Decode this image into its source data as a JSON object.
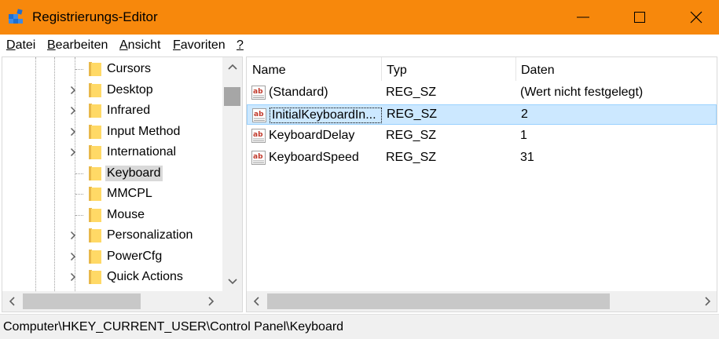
{
  "window": {
    "title": "Registrierungs-Editor",
    "icon": "registry-editor-icon"
  },
  "menu": [
    {
      "label": "Datei",
      "access_key": "D",
      "rest": "atei"
    },
    {
      "label": "Bearbeiten",
      "access_key": "B",
      "rest": "earbeiten"
    },
    {
      "label": "Ansicht",
      "access_key": "A",
      "rest": "nsicht"
    },
    {
      "label": "Favoriten",
      "access_key": "F",
      "rest": "avoriten"
    },
    {
      "label": "?",
      "access_key": "?",
      "rest": ""
    }
  ],
  "tree": {
    "nodes": [
      {
        "label": "Cursors",
        "expandable": false,
        "selected": false
      },
      {
        "label": "Desktop",
        "expandable": true,
        "selected": false
      },
      {
        "label": "Infrared",
        "expandable": true,
        "selected": false
      },
      {
        "label": "Input Method",
        "expandable": true,
        "selected": false
      },
      {
        "label": "International",
        "expandable": true,
        "selected": false
      },
      {
        "label": "Keyboard",
        "expandable": false,
        "selected": true
      },
      {
        "label": "MMCPL",
        "expandable": false,
        "selected": false
      },
      {
        "label": "Mouse",
        "expandable": false,
        "selected": false
      },
      {
        "label": "Personalization",
        "expandable": true,
        "selected": false
      },
      {
        "label": "PowerCfg",
        "expandable": true,
        "selected": false
      },
      {
        "label": "Quick Actions",
        "expandable": true,
        "selected": false
      }
    ]
  },
  "list": {
    "columns": [
      "Name",
      "Typ",
      "Daten"
    ],
    "rows": [
      {
        "name": "(Standard)",
        "type": "REG_SZ",
        "data": "(Wert nicht festgelegt)",
        "selected": false
      },
      {
        "name": "InitialKeyboardIn...",
        "type": "REG_SZ",
        "data": "2",
        "selected": true
      },
      {
        "name": "KeyboardDelay",
        "type": "REG_SZ",
        "data": "1",
        "selected": false
      },
      {
        "name": "KeyboardSpeed",
        "type": "REG_SZ",
        "data": "31",
        "selected": false
      }
    ]
  },
  "status": {
    "path": "Computer\\HKEY_CURRENT_USER\\Control Panel\\Keyboard"
  },
  "colors": {
    "titlebar": "#f7880c",
    "selection": "#cce8ff",
    "folder": "#ffd966"
  }
}
